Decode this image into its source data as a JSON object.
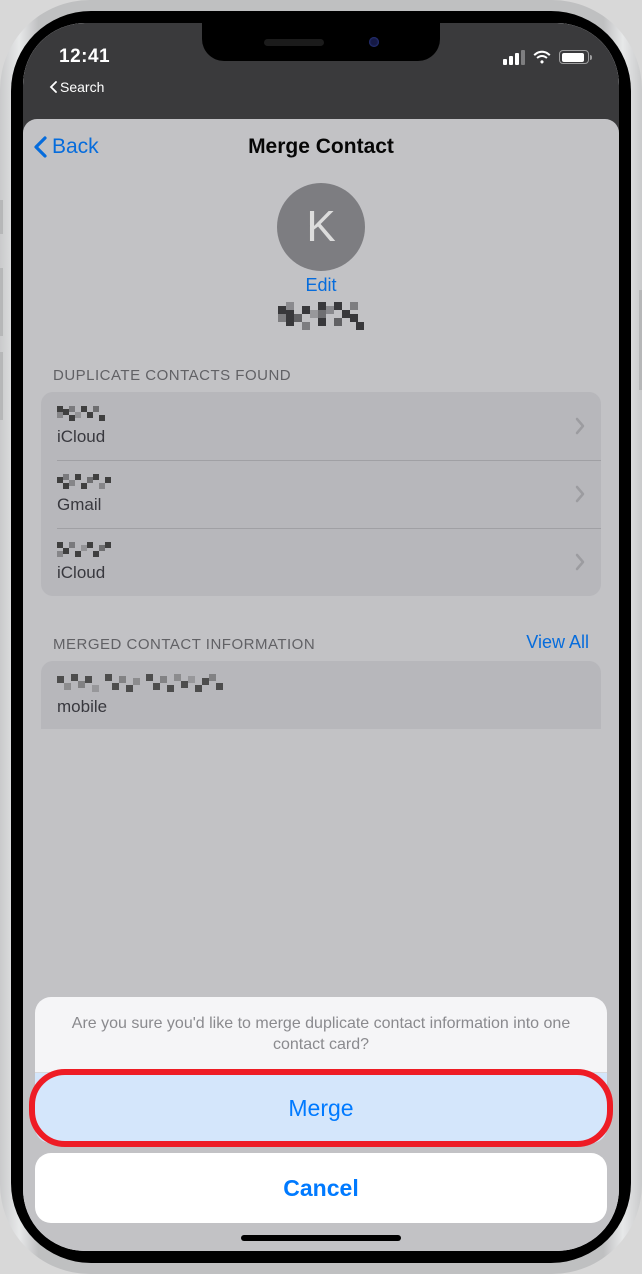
{
  "status": {
    "time": "12:41",
    "breadcrumb": "Search"
  },
  "nav": {
    "back": "Back",
    "title": "Merge Contact"
  },
  "contact": {
    "avatar_initial": "K",
    "edit": "Edit",
    "name_redacted": true
  },
  "sections": {
    "duplicates_label": "DUPLICATE CONTACTS FOUND",
    "merged_label": "MERGED CONTACT INFORMATION",
    "view_all": "View All"
  },
  "duplicates": [
    {
      "name_redacted": true,
      "source": "iCloud"
    },
    {
      "name_redacted": true,
      "source": "Gmail"
    },
    {
      "name_redacted": true,
      "source": "iCloud"
    }
  ],
  "merged_info": [
    {
      "value_redacted": true,
      "label": "mobile"
    }
  ],
  "sheet": {
    "message": "Are you sure you'd like to merge duplicate contact information into one contact card?",
    "merge": "Merge",
    "cancel": "Cancel"
  }
}
